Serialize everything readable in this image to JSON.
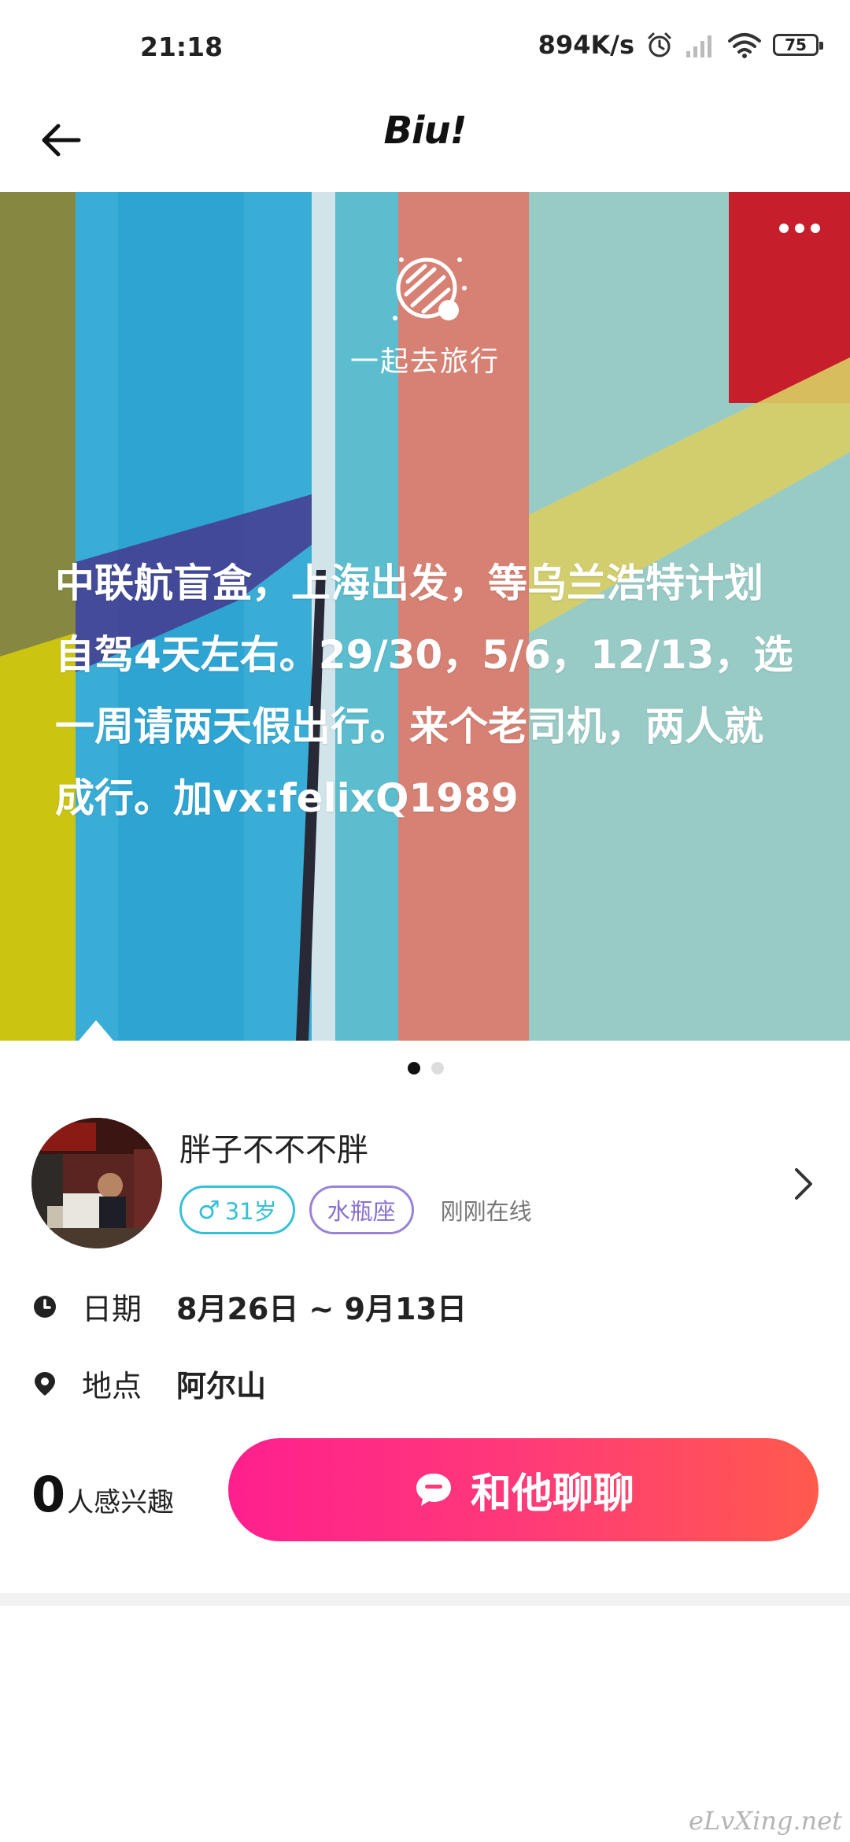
{
  "status_bar": {
    "time": "21:18",
    "speed": "894K/s",
    "battery": "75"
  },
  "header": {
    "app_logo": "Biu!"
  },
  "post": {
    "topic_label": "一起去旅行",
    "text": "中联航盲盒，上海出发，等乌兰浩特计划自驾4天左右。29/30，5/6，12/13，选一周请两天假出行。来个老司机，两人就成行。加vx:felixQ1989",
    "pager": {
      "total": 2,
      "active": 0
    }
  },
  "user": {
    "name": "胖子不不不胖",
    "gender_symbol": "♂",
    "age": "31岁",
    "zodiac": "水瓶座",
    "status": "刚刚在线"
  },
  "details": {
    "date_label": "日期",
    "date_value": "8月26日 ~ 9月13日",
    "location_label": "地点",
    "location_value": "阿尔山"
  },
  "actions": {
    "interest_count": "0",
    "interest_label": "人感兴趣",
    "chat_button": "和他聊聊"
  },
  "watermark": "eLvXing.net",
  "colors": {
    "chat_gradient_start": "#ff1f8e",
    "chat_gradient_end": "#ff5a4d",
    "gender_tag": "#36c0d8",
    "zodiac_tag": "#8a70cf"
  }
}
